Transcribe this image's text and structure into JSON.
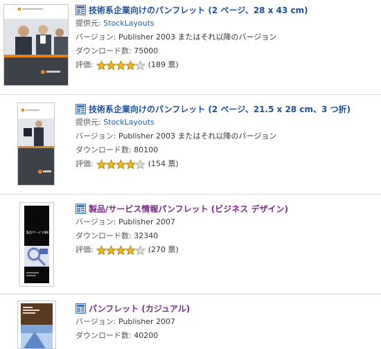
{
  "labels": {
    "provider": "提供元:",
    "version": "バージョン:",
    "downloads": "ダウンロード数:",
    "rating": "評価:"
  },
  "icons": {
    "doc": "publisher-doc-icon",
    "star": "star-icon"
  },
  "colors": {
    "title_blue": "#1a4f9e",
    "title_purple": "#7a2a8a",
    "link": "#1a5fb0",
    "star_fill": "#f2b51c",
    "star_empty": "#dddddd"
  },
  "items": [
    {
      "title": "技術系企業向けのパンフレット (2 ページ、28 x 43 cm)",
      "provider": "StockLayouts",
      "version": "Publisher 2003 またはそれ以降のバージョン",
      "downloads": "75000",
      "rating": 4,
      "votes": "(189 票)"
    },
    {
      "title": "技術系企業向けのパンフレット (2 ページ、21.5 x 28 cm、3 つ折)",
      "provider": "StockLayouts",
      "version": "Publisher 2003 またはそれ以降のバージョン",
      "downloads": "80100",
      "rating": 4,
      "votes": "(154 票)"
    },
    {
      "title": "製品/サービス情報パンフレット (ビジネス デザイン)",
      "thumb_text": "製品/サービス情報パ",
      "version": "Publisher 2007",
      "downloads": "32340",
      "rating": 4,
      "votes": "(270 票)"
    },
    {
      "title": "パンフレット (カジュアル)",
      "version": "Publisher 2007",
      "downloads": "40200"
    }
  ]
}
